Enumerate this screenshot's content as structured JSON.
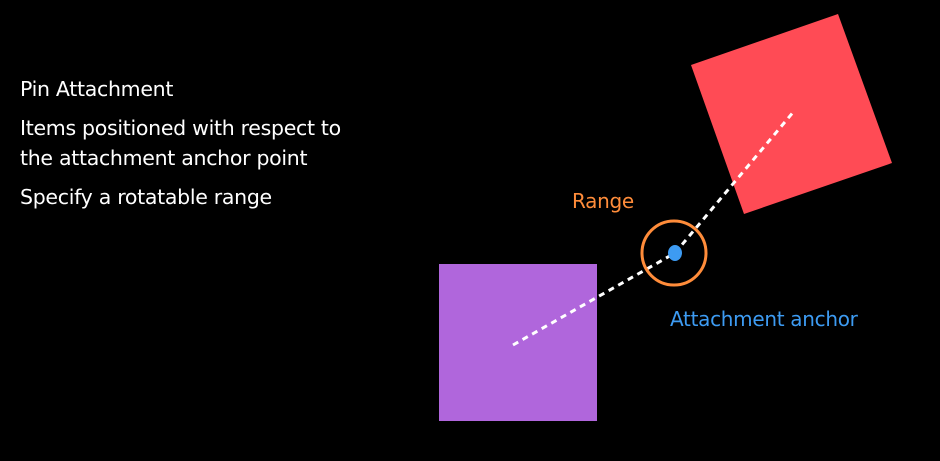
{
  "slide": {
    "title": "Pin Attachment",
    "bullets": [
      "Items positioned with respect to the attachment anchor point",
      "Specify a rotatable range"
    ]
  },
  "diagram": {
    "labels": {
      "range": "Range",
      "anchor": "Attachment anchor"
    },
    "colors": {
      "background": "#000000",
      "text": "#ffffff",
      "purple_square": "#b066dc",
      "red_square": "#ff4b55",
      "range_ring": "#ff8c3a",
      "anchor": "#3d9bf2",
      "dashed_line": "#ffffff"
    }
  }
}
